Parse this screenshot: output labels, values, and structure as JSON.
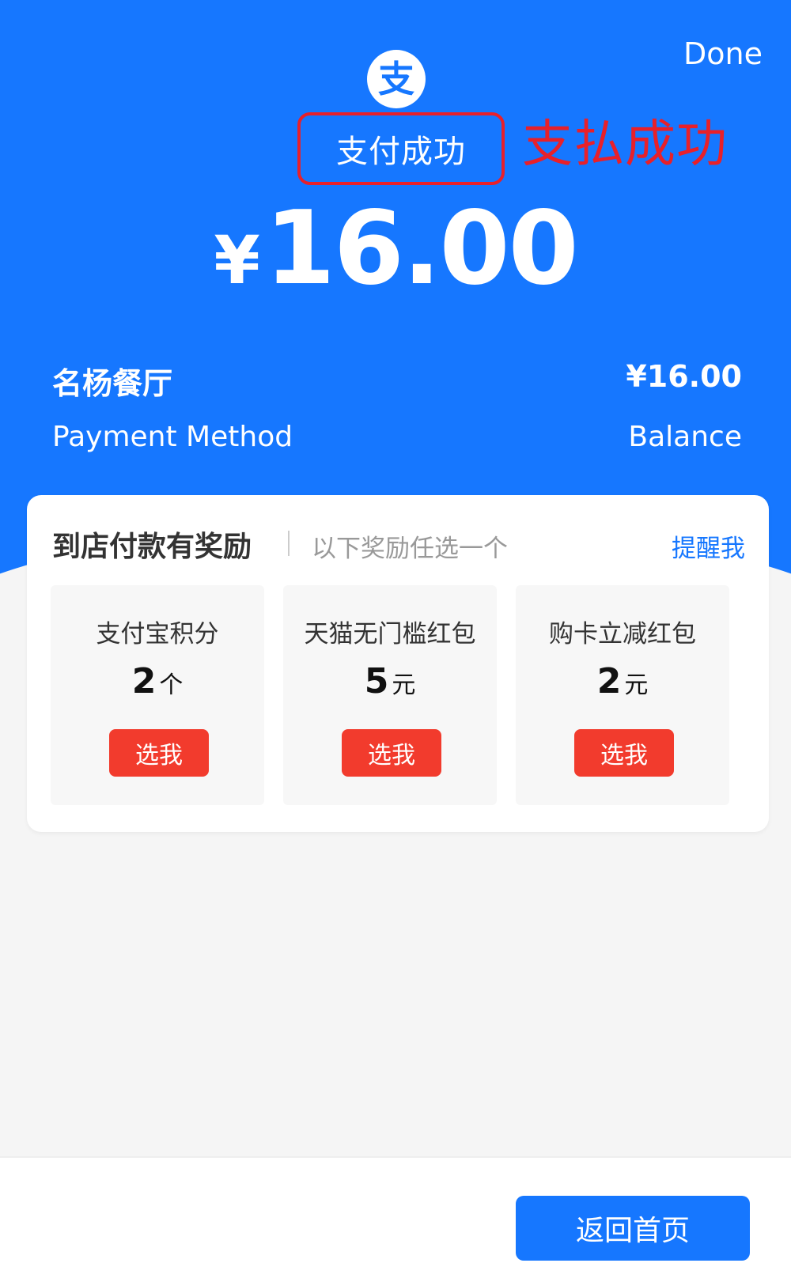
{
  "header": {
    "done_label": "Done",
    "logo_glyph": "支",
    "status_text": "支付成功",
    "status_annotation": "支払成功",
    "currency_symbol": "¥",
    "amount": "16.00"
  },
  "details": {
    "merchant_name": "名杨餐厅",
    "merchant_amount": "¥16.00",
    "method_label": "Payment Method",
    "method_value": "Balance"
  },
  "rewards": {
    "title": "到店付款有奖励",
    "subtitle": "以下奖励任选一个",
    "remind_label": "提醒我",
    "items": [
      {
        "name": "支付宝积分",
        "amount": "2",
        "unit": "个",
        "button": "选我"
      },
      {
        "name": "天猫无门槛红包",
        "amount": "5",
        "unit": "元",
        "button": "选我"
      },
      {
        "name": "购卡立减红包",
        "amount": "2",
        "unit": "元",
        "button": "选我"
      }
    ]
  },
  "footer": {
    "home_label": "返回首页"
  },
  "colors": {
    "brand_blue": "#1677ff",
    "annotation_red": "#e8202a",
    "button_red": "#f23b2d"
  }
}
